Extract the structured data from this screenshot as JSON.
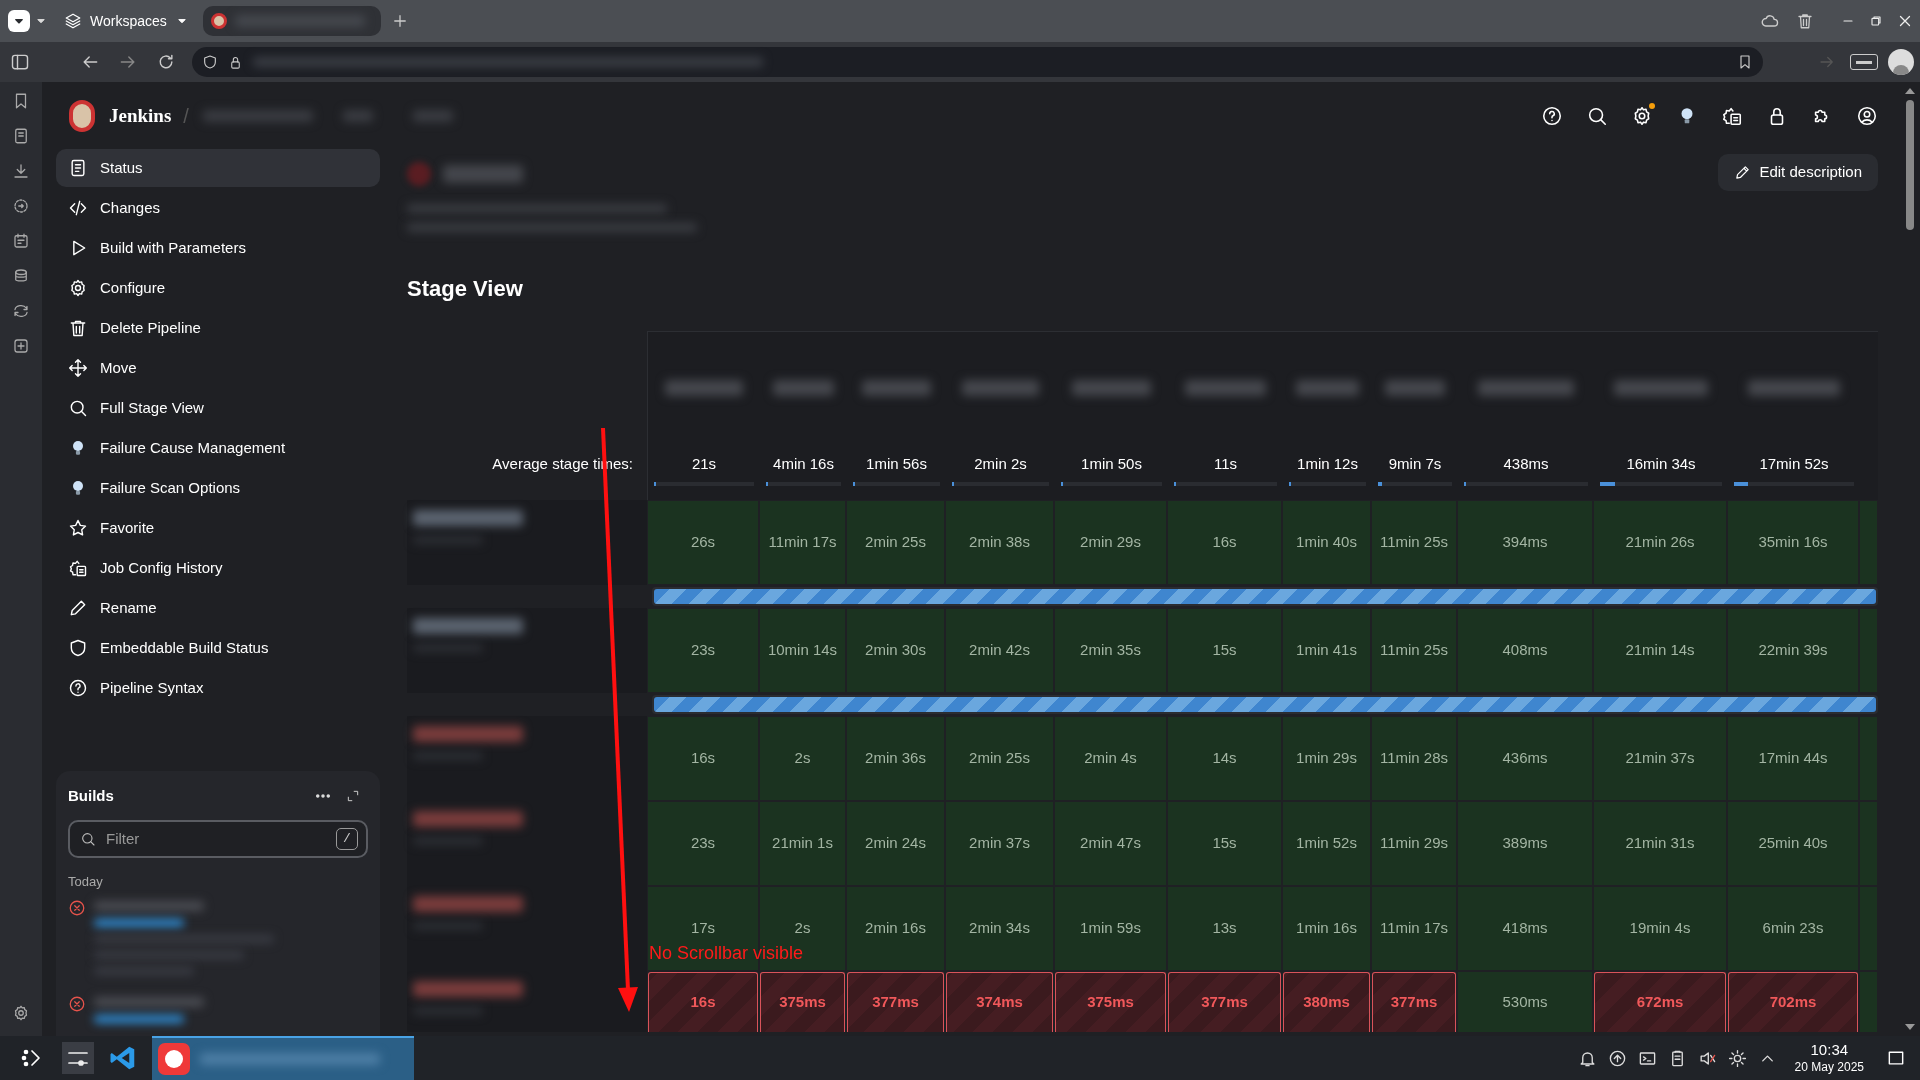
{
  "browser": {
    "workspaces_label": "Workspaces"
  },
  "header": {
    "breadcrumb_root": "Jenkins",
    "breadcrumb_separator": "/"
  },
  "sidebar": {
    "items": [
      {
        "label": "Status",
        "selected": true
      },
      {
        "label": "Changes",
        "selected": false
      },
      {
        "label": "Build with Parameters",
        "selected": false
      },
      {
        "label": "Configure",
        "selected": false
      },
      {
        "label": "Delete Pipeline",
        "selected": false
      },
      {
        "label": "Move",
        "selected": false
      },
      {
        "label": "Full Stage View",
        "selected": false
      },
      {
        "label": "Failure Cause Management",
        "selected": false
      },
      {
        "label": "Failure Scan Options",
        "selected": false
      },
      {
        "label": "Favorite",
        "selected": false
      },
      {
        "label": "Job Config History",
        "selected": false
      },
      {
        "label": "Rename",
        "selected": false
      },
      {
        "label": "Embeddable Build Status",
        "selected": false
      },
      {
        "label": "Pipeline Syntax",
        "selected": false
      }
    ]
  },
  "builds": {
    "title": "Builds",
    "filter": {
      "placeholder": "Filter",
      "shortcut": "/"
    },
    "group": "Today",
    "entries": [
      {
        "failed": true
      },
      {
        "failed": true
      }
    ]
  },
  "page": {
    "edit_button": "Edit description",
    "section_title": "Stage View"
  },
  "stage_view": {
    "average_label": "Average stage times:",
    "averages": [
      {
        "time": "21s",
        "level": 0.01
      },
      {
        "time": "4min 16s",
        "level": 0.01
      },
      {
        "time": "1min 56s",
        "level": 0.01
      },
      {
        "time": "2min 2s",
        "level": 0.01
      },
      {
        "time": "1min 50s",
        "level": 0.01
      },
      {
        "time": "11s",
        "level": 0.01
      },
      {
        "time": "1min 12s",
        "level": 0.01
      },
      {
        "time": "9min 7s",
        "level": 0.05
      },
      {
        "time": "438ms",
        "level": 0.01
      },
      {
        "time": "16min 34s",
        "level": 0.12
      },
      {
        "time": "17min 52s",
        "level": 0.12
      }
    ],
    "rows": [
      {
        "kind": "stages",
        "build_failed": false,
        "cells": [
          {
            "time": "26s",
            "failed": false
          },
          {
            "time": "11min 17s",
            "failed": false
          },
          {
            "time": "2min 25s",
            "failed": false
          },
          {
            "time": "2min 38s",
            "failed": false
          },
          {
            "time": "2min 29s",
            "failed": false
          },
          {
            "time": "16s",
            "failed": false
          },
          {
            "time": "1min 40s",
            "failed": false
          },
          {
            "time": "11min 25s",
            "failed": false
          },
          {
            "time": "394ms",
            "failed": false
          },
          {
            "time": "21min 26s",
            "failed": false
          },
          {
            "time": "35min 16s",
            "failed": false
          },
          {
            "failed": false
          }
        ]
      },
      {
        "kind": "progress",
        "level": 1
      },
      {
        "kind": "stages",
        "build_failed": false,
        "cells": [
          {
            "time": "23s",
            "failed": false
          },
          {
            "time": "10min 14s",
            "failed": false
          },
          {
            "time": "2min 30s",
            "failed": false
          },
          {
            "time": "2min 42s",
            "failed": false
          },
          {
            "time": "2min 35s",
            "failed": false
          },
          {
            "time": "15s",
            "failed": false
          },
          {
            "time": "1min 41s",
            "failed": false
          },
          {
            "time": "11min 25s",
            "failed": false
          },
          {
            "time": "408ms",
            "failed": false
          },
          {
            "time": "21min 14s",
            "failed": false
          },
          {
            "time": "22min 39s",
            "failed": false
          },
          {
            "failed": false
          }
        ]
      },
      {
        "kind": "progress",
        "level": 1
      },
      {
        "kind": "stages",
        "build_failed": true,
        "cells": [
          {
            "time": "16s",
            "failed": false
          },
          {
            "time": "2s",
            "failed": false
          },
          {
            "time": "2min 36s",
            "failed": false
          },
          {
            "time": "2min 25s",
            "failed": false
          },
          {
            "time": "2min 4s",
            "failed": false
          },
          {
            "time": "14s",
            "failed": false
          },
          {
            "time": "1min 29s",
            "failed": false
          },
          {
            "time": "11min 28s",
            "failed": false
          },
          {
            "time": "436ms",
            "failed": false
          },
          {
            "time": "21min 37s",
            "failed": false
          },
          {
            "time": "17min 44s",
            "failed": false
          },
          {
            "failed": false
          }
        ]
      },
      {
        "kind": "stages",
        "build_failed": true,
        "cells": [
          {
            "time": "23s",
            "failed": false
          },
          {
            "time": "21min 1s",
            "failed": false
          },
          {
            "time": "2min 24s",
            "failed": false
          },
          {
            "time": "2min 37s",
            "failed": false
          },
          {
            "time": "2min 47s",
            "failed": false
          },
          {
            "time": "15s",
            "failed": false
          },
          {
            "time": "1min 52s",
            "failed": false
          },
          {
            "time": "11min 29s",
            "failed": false
          },
          {
            "time": "389ms",
            "failed": false
          },
          {
            "time": "21min 31s",
            "failed": false
          },
          {
            "time": "25min 40s",
            "failed": false
          },
          {
            "failed": false
          }
        ]
      },
      {
        "kind": "stages",
        "build_failed": true,
        "cells": [
          {
            "time": "17s",
            "failed": false
          },
          {
            "time": "2s",
            "failed": false
          },
          {
            "time": "2min 16s",
            "failed": false
          },
          {
            "time": "2min 34s",
            "failed": false
          },
          {
            "time": "1min 59s",
            "failed": false
          },
          {
            "time": "13s",
            "failed": false
          },
          {
            "time": "1min 16s",
            "failed": false
          },
          {
            "time": "11min 17s",
            "failed": false
          },
          {
            "time": "418ms",
            "failed": false
          },
          {
            "time": "19min 4s",
            "failed": false
          },
          {
            "time": "6min 23s",
            "failed": false
          },
          {
            "failed": false
          }
        ]
      },
      {
        "kind": "stages",
        "build_failed": true,
        "cells": [
          {
            "time": "16s",
            "failed": true
          },
          {
            "time": "375ms",
            "failed": true
          },
          {
            "time": "377ms",
            "failed": true
          },
          {
            "time": "374ms",
            "failed": true
          },
          {
            "time": "375ms",
            "failed": true
          },
          {
            "time": "377ms",
            "failed": true
          },
          {
            "time": "380ms",
            "failed": true
          },
          {
            "time": "377ms",
            "failed": true
          },
          {
            "time": "530ms",
            "failed": false
          },
          {
            "time": "672ms",
            "failed": true
          },
          {
            "time": "702ms",
            "failed": true
          },
          {
            "failed": false
          }
        ]
      }
    ]
  },
  "annotation": {
    "text": "No Scrollbar visible"
  },
  "taskbar": {
    "time": "10:34",
    "date": "20 May 2025"
  }
}
